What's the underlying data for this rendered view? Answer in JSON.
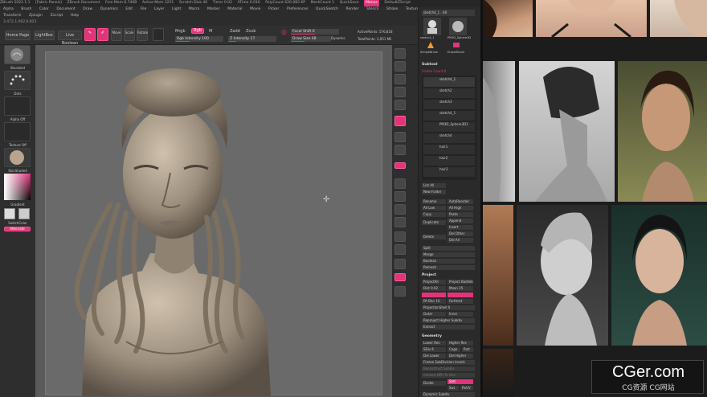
{
  "titlebar": {
    "items": [
      "ZBrush 2021.1.1",
      "[Fabric Panels]",
      "ZBrush Document",
      "Free Mem 6.740B",
      "Active Mem 3251",
      "Scratch Disk 46",
      "Timer 0.02",
      "ATime 0.016",
      "PolyCount 620.083 KP",
      "MeshCount 1",
      "QuickSave",
      "Menus",
      "DefaultZScript"
    ]
  },
  "menus": {
    "row1": [
      "Alpha",
      "Brush",
      "Color",
      "Document",
      "Draw",
      "Dynamics",
      "Edit",
      "File",
      "Layer",
      "Light",
      "Macro",
      "Marker",
      "Material",
      "Movie",
      "Picker",
      "Preferences",
      "QuickSketch",
      "Render",
      "Stencil",
      "Stroke",
      "Texture",
      "Tool"
    ],
    "row2": [
      "Transform",
      "Zplugin",
      "Zscript",
      "Help"
    ],
    "coords": "3.472,1.002,0.821"
  },
  "toolbar": {
    "home_page": "Home Page",
    "lightbox": "LightBox",
    "live_boolean": "Live Boolean",
    "edit": "Edit",
    "draw": "Draw",
    "move": "Move",
    "scale": "Scale",
    "rotate": "Rotate",
    "mrgb": "Mrgb",
    "rgb": "Rgb",
    "m": "M",
    "rgb_intensity": "Rgb Intensity 100",
    "zadd": "Zadd",
    "zsub": "Zsub",
    "z_intensity": "Z Intensity 17",
    "focal_shift": "Focal Shift 0",
    "draw_size": "Draw Size 68",
    "dynamic": "Dynamic",
    "active_points": "ActivePoints: 576,818",
    "total_points": "TotalPoints: 3,951 Mil"
  },
  "left_tray": {
    "brush": "Standard",
    "stroke": "Dots",
    "alpha": "Alpha Off",
    "texture": "Texture Off",
    "material": "SkinShade4",
    "gradient": "Gradient",
    "switch_color": "SwitchColor",
    "alternate": "Alternate"
  },
  "panel": {
    "tool_name": "sketch4_1 . 48",
    "tool_thumbs": [
      "sketch4_1",
      "PM3D_Sphere3D",
      "SimpleBrush",
      "EraserBrush"
    ],
    "subtool_title": "Subtool",
    "visible_count": "Visible Count 8",
    "subtools": [
      "sketch4_1",
      "sketch2",
      "sketch3",
      "sketch4_1",
      "PM3D_Sphere3D1",
      "sketch4",
      "hair1",
      "hair2",
      "hair3"
    ],
    "list_all": "List All",
    "new_folder": "New Folder",
    "ops": [
      "Rename",
      "AutoReorder",
      "All Low",
      "All High",
      "Copy",
      "Paste",
      "Duplicate",
      "Append",
      "Insert",
      "Delete",
      "Del Other",
      "Del All"
    ],
    "split": "Split",
    "merge": "Merge",
    "boolean": "Boolean",
    "remesh": "Remesh",
    "project_title": "Project",
    "project_items": [
      "ProjectAll",
      "Project BasRelief",
      "Dist 0.02",
      "Mean 25",
      "PA Blur 10",
      "Farthest",
      "ProjectionShell 0",
      "Outer",
      "Inner",
      "Reproject Higher Subdiv",
      "Extract"
    ],
    "geometry_title": "Geometry",
    "geometry_items": [
      "Lower Res",
      "Higher Res",
      "SDiv 6",
      "Cage",
      "Rstr",
      "Del Lower",
      "Del Higher",
      "Freeze SubDivision Levels",
      "Reconstruct Subdiv",
      "Convert BPR To Geo",
      "Divide",
      "Smt",
      "Suv",
      "ReUV",
      "Dynamic Subdiv"
    ]
  },
  "watermark": {
    "line1": "CGer.com",
    "line2": "CG资源 CG网站"
  },
  "colors": {
    "accent": "#e0357a",
    "bg": "#333333",
    "canvas": "#6a6a6a"
  }
}
